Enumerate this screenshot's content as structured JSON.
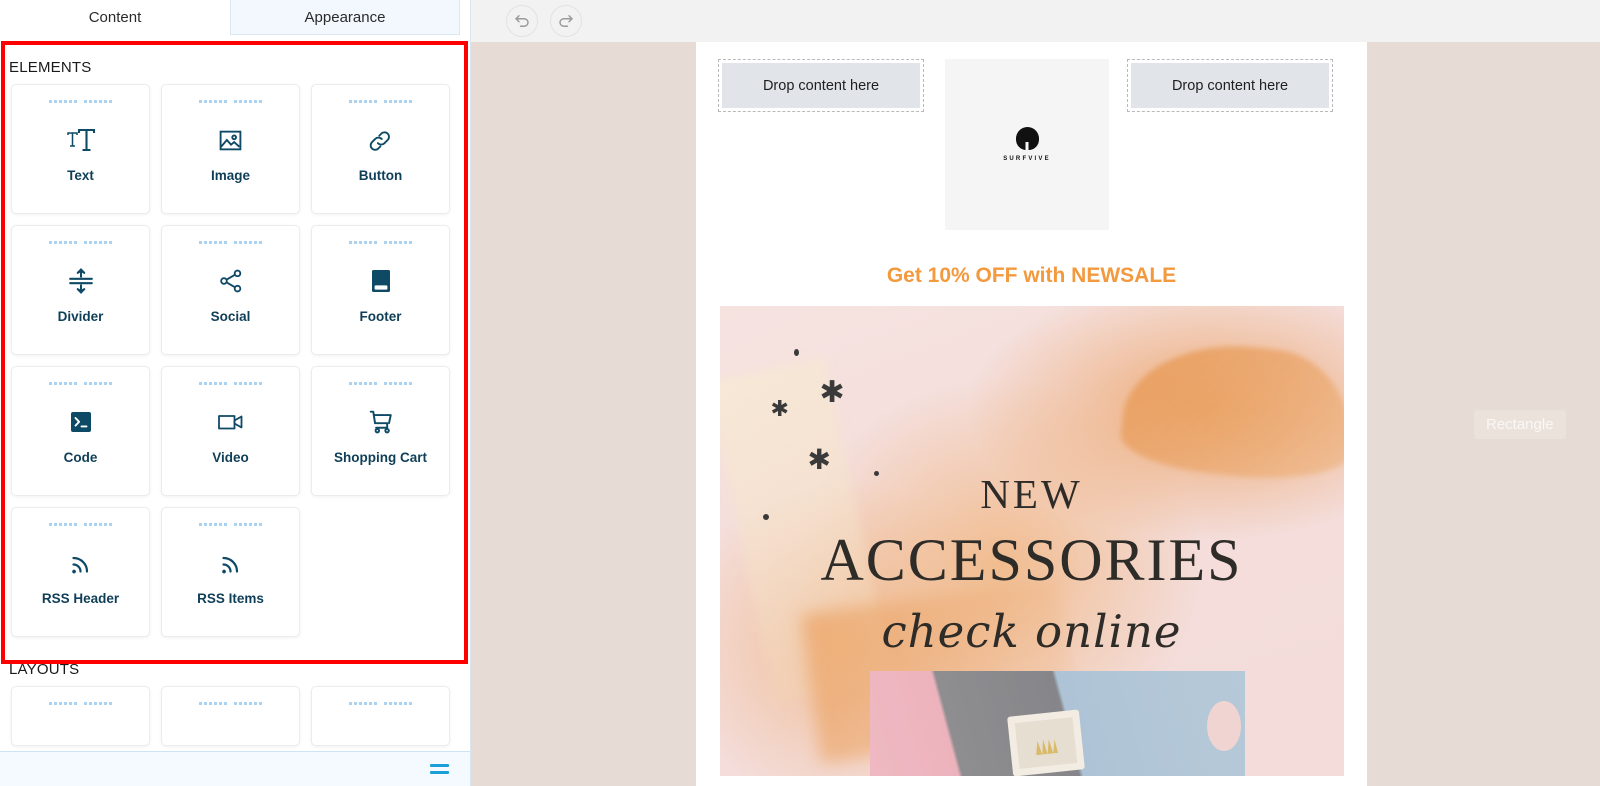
{
  "tabs": [
    {
      "label": "Content",
      "active": true
    },
    {
      "label": "Appearance",
      "active": false
    }
  ],
  "sidebar": {
    "sections": [
      {
        "title": "ELEMENTS",
        "items": [
          {
            "label": "Text",
            "icon": "text-icon"
          },
          {
            "label": "Image",
            "icon": "image-icon"
          },
          {
            "label": "Button",
            "icon": "link-icon"
          },
          {
            "label": "Divider",
            "icon": "divider-icon"
          },
          {
            "label": "Social",
            "icon": "share-icon"
          },
          {
            "label": "Footer",
            "icon": "footer-icon"
          },
          {
            "label": "Code",
            "icon": "terminal-icon"
          },
          {
            "label": "Video",
            "icon": "video-camera-icon"
          },
          {
            "label": "Shopping Cart",
            "icon": "shopping-cart-icon"
          },
          {
            "label": "RSS Header",
            "icon": "rss-icon"
          },
          {
            "label": "RSS Items",
            "icon": "rss-icon"
          }
        ]
      },
      {
        "title": "LAYOUTS",
        "items": [
          {
            "label": "",
            "icon": "layout-icon"
          },
          {
            "label": "",
            "icon": "layout-icon"
          },
          {
            "label": "",
            "icon": "layout-icon"
          }
        ]
      }
    ],
    "bottom_bar_icon": "list-lines-icon"
  },
  "toolbar": {
    "undo_label": "Undo",
    "undo_icon": "undo-arrow-icon",
    "redo_label": "Redo",
    "redo_icon": "redo-arrow-icon"
  },
  "canvas": {
    "drop_zone_left": "Drop content here",
    "drop_zone_right": "Drop content here",
    "logo_text": "SURFVIVE",
    "promo_text": "Get 10% OFF with NEWSALE",
    "hero": {
      "line1": "NEW",
      "line2": "ACCESSORIES",
      "line3": "check online"
    },
    "rectangle_label": "Rectangle"
  },
  "colors": {
    "annotation": "#ff0000",
    "promo_orange": "#f3993e",
    "icon_navy": "#0f3e57",
    "canvas_bg": "#e7dcd5",
    "accent_blue": "#1b9fd8",
    "dot_blue": "#a9d3f0"
  }
}
